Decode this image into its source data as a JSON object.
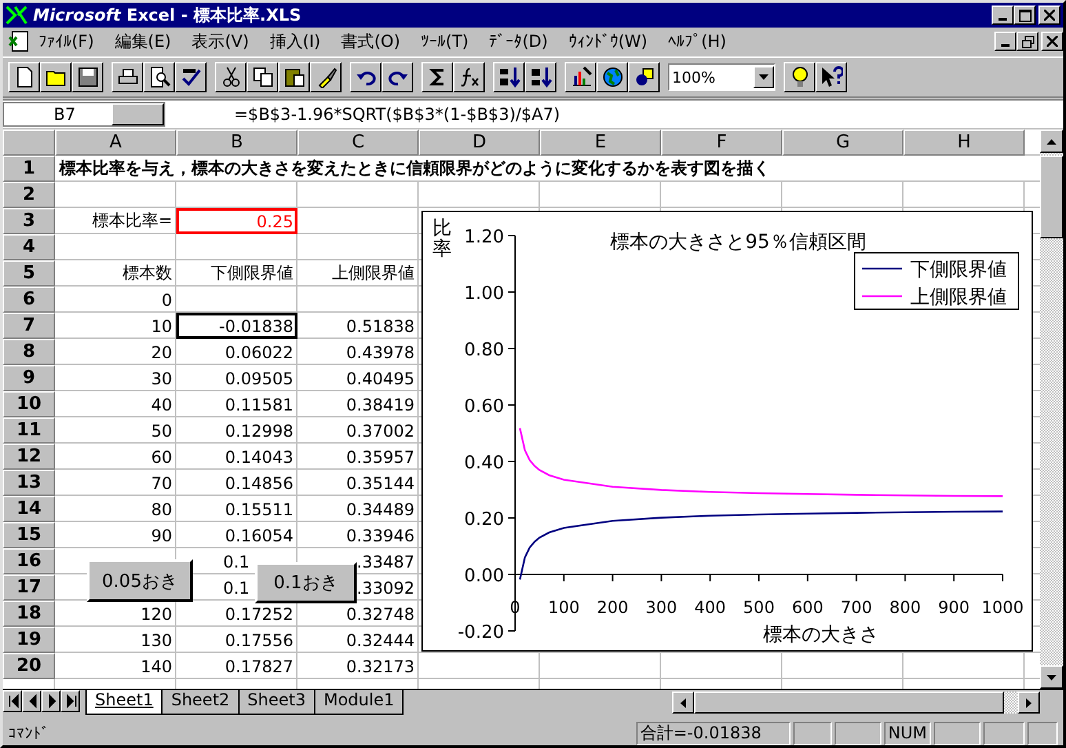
{
  "window": {
    "title": "*Microsoft* Excel - 標本比率.XLS"
  },
  "menu": [
    "ﾌｧｲﾙ(F)",
    "編集(E)",
    "表示(V)",
    "挿入(I)",
    "書式(O)",
    "ﾂｰﾙ(T)",
    "ﾃﾞｰﾀ(D)",
    "ｳｨﾝﾄﾞｳ(W)",
    "ﾍﾙﾌﾟ(H)"
  ],
  "toolbar": {
    "zoom": "100%"
  },
  "formula_bar": {
    "cell": "B7",
    "formula": "=$B$3-1.96*SQRT($B$3*(1-$B$3)/$A7)"
  },
  "sheet": {
    "columns": [
      "A",
      "B",
      "C",
      "D",
      "E",
      "F",
      "G",
      "H"
    ],
    "rows": [
      {
        "header": "1",
        "kind": "title",
        "cells": [
          {
            "text": "標本比率を与え，標本の大きさを変えたときに信頼限界がどのように変化するかを表す図を描く",
            "selected": false
          }
        ]
      },
      {
        "header": "2",
        "kind": "data"
      },
      {
        "header": "3",
        "kind": "data",
        "cells": [
          {
            "text": "標本比率=",
            "selected": false
          },
          {
            "text": "0.25",
            "selected": false,
            "color": "#ff0000"
          }
        ]
      },
      {
        "header": "4",
        "kind": "data"
      },
      {
        "header": "5",
        "kind": "data",
        "cells": [
          {
            "text": "標本数",
            "selected": false
          },
          {
            "text": "下側限界値",
            "selected": false
          },
          {
            "text": "上側限界値",
            "selected": false
          }
        ]
      },
      {
        "header": "6",
        "kind": "data",
        "cells": [
          {
            "text": "0",
            "selected": false
          }
        ]
      },
      {
        "header": "7",
        "kind": "data",
        "cells": [
          {
            "text": "10",
            "selected": false
          },
          {
            "text": "-0.01838",
            "selected": true
          },
          {
            "text": "0.51838",
            "selected": false
          }
        ]
      },
      {
        "header": "8",
        "kind": "data",
        "cells": [
          {
            "text": "20",
            "selected": false
          },
          {
            "text": "0.06022",
            "selected": false
          },
          {
            "text": "0.43978",
            "selected": false
          }
        ]
      },
      {
        "header": "9",
        "kind": "data",
        "cells": [
          {
            "text": "30",
            "selected": false
          },
          {
            "text": "0.09505",
            "selected": false
          },
          {
            "text": "0.40495",
            "selected": false
          }
        ]
      },
      {
        "header": "10",
        "kind": "data",
        "cells": [
          {
            "text": "40",
            "selected": false
          },
          {
            "text": "0.11581",
            "selected": false
          },
          {
            "text": "0.38419",
            "selected": false
          }
        ]
      },
      {
        "header": "11",
        "kind": "data",
        "cells": [
          {
            "text": "50",
            "selected": false
          },
          {
            "text": "0.12998",
            "selected": false
          },
          {
            "text": "0.37002",
            "selected": false
          }
        ]
      },
      {
        "header": "12",
        "kind": "data",
        "cells": [
          {
            "text": "60",
            "selected": false
          },
          {
            "text": "0.14043",
            "selected": false
          },
          {
            "text": "0.35957",
            "selected": false
          }
        ]
      },
      {
        "header": "13",
        "kind": "data",
        "cells": [
          {
            "text": "70",
            "selected": false
          },
          {
            "text": "0.14856",
            "selected": false
          },
          {
            "text": "0.35144",
            "selected": false
          }
        ]
      },
      {
        "header": "14",
        "kind": "data",
        "cells": [
          {
            "text": "80",
            "selected": false
          },
          {
            "text": "0.15511",
            "selected": false
          },
          {
            "text": "0.34489",
            "selected": false
          }
        ]
      },
      {
        "header": "15",
        "kind": "data",
        "cells": [
          {
            "text": "90",
            "selected": false
          },
          {
            "text": "0.16054",
            "selected": false
          },
          {
            "text": "0.33946",
            "selected": false
          }
        ]
      },
      {
        "header": "16",
        "kind": "covered",
        "cells": [
          {
            "text": "0.1",
            "selected": false
          },
          {
            "text": ".33487",
            "selected": false
          }
        ]
      },
      {
        "header": "17",
        "kind": "covered",
        "cells": [
          {
            "text": "0.1",
            "selected": false
          },
          {
            "text": ".33092",
            "selected": false
          }
        ]
      },
      {
        "header": "18",
        "kind": "data",
        "cells": [
          {
            "text": "120",
            "selected": false
          },
          {
            "text": "0.17252",
            "selected": false
          },
          {
            "text": "0.32748",
            "selected": false
          }
        ]
      },
      {
        "header": "19",
        "kind": "data",
        "cells": [
          {
            "text": "130",
            "selected": false
          },
          {
            "text": "0.17556",
            "selected": false
          },
          {
            "text": "0.32444",
            "selected": false
          }
        ]
      },
      {
        "header": "20",
        "kind": "data",
        "cells": [
          {
            "text": "140",
            "selected": false
          },
          {
            "text": "0.17827",
            "selected": false
          },
          {
            "text": "0.32173",
            "selected": false
          }
        ]
      }
    ]
  },
  "chart": {
    "chart_data": {
      "type": "line",
      "title": "標本の大きさと95％信頼区間",
      "xlabel": "標本の大きさ",
      "ylabel": "比率",
      "x": [
        10,
        20,
        30,
        40,
        50,
        70,
        100,
        200,
        300,
        400,
        500,
        600,
        700,
        800,
        900,
        1000
      ],
      "series": [
        {
          "name": "下側限界値",
          "color": "#000080",
          "values": [
            -0.018,
            0.06,
            0.095,
            0.116,
            0.13,
            0.149,
            0.165,
            0.19,
            0.201,
            0.208,
            0.212,
            0.215,
            0.218,
            0.22,
            0.222,
            0.223
          ]
        },
        {
          "name": "上側限界値",
          "color": "#ff00ff",
          "values": [
            0.518,
            0.44,
            0.405,
            0.384,
            0.37,
            0.351,
            0.335,
            0.31,
            0.299,
            0.292,
            0.288,
            0.285,
            0.282,
            0.28,
            0.278,
            0.277
          ]
        }
      ],
      "legend": "upper right",
      "xlim": [
        0,
        1000
      ],
      "ylim": [
        -0.2,
        1.2
      ],
      "xticks": [
        0,
        100,
        200,
        300,
        400,
        500,
        600,
        700,
        800,
        900,
        1000
      ],
      "yticks": [
        {
          "value": -0.2,
          "label": "-0.20"
        },
        {
          "value": 0,
          "label": "0.00"
        },
        {
          "value": 0.2,
          "label": "0.20"
        },
        {
          "value": 0.4,
          "label": "0.40"
        },
        {
          "value": 0.6,
          "label": "0.60"
        },
        {
          "value": 0.8,
          "label": "0.80"
        },
        {
          "value": 1.0,
          "label": "1.00"
        },
        {
          "value": 1.2,
          "label": "1.20"
        }
      ]
    }
  },
  "buttons": [
    "0.05おき",
    "0.1おき"
  ],
  "sheet_tabs": [
    {
      "label": "Sheet1",
      "selected": true
    },
    {
      "label": "Sheet2",
      "selected": false
    },
    {
      "label": "Sheet3",
      "selected": false
    },
    {
      "label": "Module1",
      "selected": false
    }
  ],
  "status_bar": {
    "mode": "ｺﾏﾝﾄﾞ",
    "sum": "合計=-0.01838",
    "indicators": [
      "NUM"
    ]
  }
}
